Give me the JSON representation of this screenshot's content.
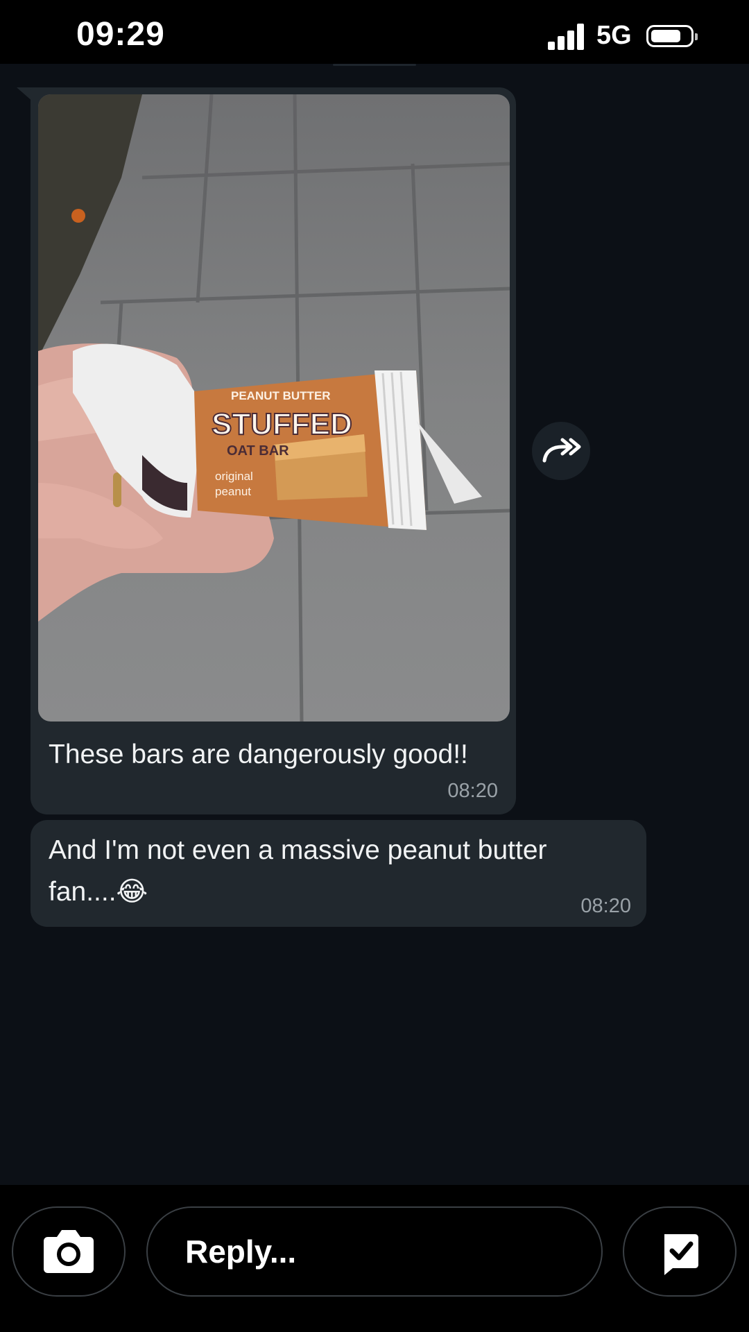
{
  "status_bar": {
    "time": "09:29",
    "network": "5G",
    "icons": [
      "signal-bars-icon",
      "battery-icon"
    ]
  },
  "messages": [
    {
      "type": "image",
      "image_description_icon": "photo",
      "image_label_line1": "PEANUT BUTTER",
      "image_label_line2": "STUFFED",
      "image_label_line3": "OAT BAR",
      "image_label_line4": "original",
      "image_label_line5": "peanut",
      "text": "These bars are dangerously good!!",
      "time": "08:20"
    },
    {
      "type": "text",
      "text_line1": "And I'm not even a massive peanut butter",
      "text_line2": "fan....😂",
      "time": "08:20"
    }
  ],
  "forward_button": {
    "icon": "forward-arrow-icon"
  },
  "composer": {
    "placeholder": "Reply...",
    "camera_icon": "camera-icon",
    "action_icon": "check-chat-icon"
  },
  "colors": {
    "background": "#0c1016",
    "bubble": "#21282e",
    "bar": "#000000"
  }
}
